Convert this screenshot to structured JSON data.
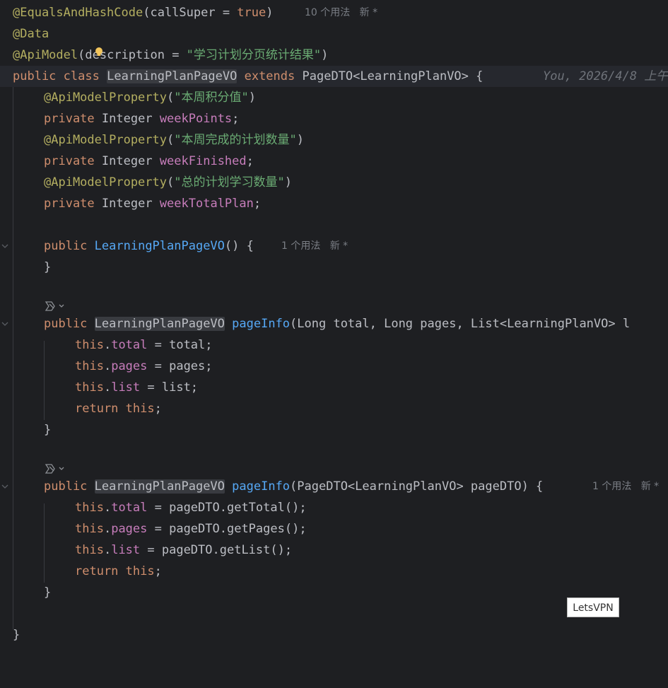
{
  "editor": {
    "language": "java",
    "colors": {
      "background": "#1e1f22",
      "annotation": "#b3ae60",
      "keyword": "#cf8e6d",
      "string": "#6aab73",
      "field": "#c77dbb",
      "method": "#56a8f5",
      "text": "#bcbec4",
      "hint": "#7a7e85"
    },
    "icons": {
      "bulb": "lightbulb-icon",
      "ai": "ai-assistant-icon",
      "fold": "fold-chevron-icon"
    }
  },
  "code": {
    "l1": {
      "ann": "@EqualsAndHashCode",
      "p1": "(callSuper = ",
      "kw": "true",
      "p2": ")",
      "hint1": "10 个用法",
      "hint2": "新 *"
    },
    "l2": {
      "ann": "@Data"
    },
    "l3": {
      "ann": "@ApiModel",
      "p1": "(d",
      "p2": "escription = ",
      "str": "\"学习计划分页统计结果\"",
      "p3": ")"
    },
    "l4": {
      "kw1": "public",
      "kw2": "class",
      "cls": "LearningPlanPageVO",
      "kw3": "extends",
      "rest": "PageDTO<LearningPlanVO> {",
      "blame": "You, 2026/4/8 上午"
    },
    "l5": {
      "ann": "@ApiModelProperty",
      "p1": "(",
      "str": "\"本周积分值\"",
      "p2": ")"
    },
    "l6": {
      "kw": "private",
      "type": "Integer",
      "fld": "weekPoints",
      "p": ";"
    },
    "l7": {
      "ann": "@ApiModelProperty",
      "p1": "(",
      "str": "\"本周完成的计划数量\"",
      "p2": ")"
    },
    "l8": {
      "kw": "private",
      "type": "Integer",
      "fld": "weekFinished",
      "p": ";"
    },
    "l9": {
      "ann": "@ApiModelProperty",
      "p1": "(",
      "str": "\"总的计划学习数量\"",
      "p2": ")"
    },
    "l10": {
      "kw": "private",
      "type": "Integer",
      "fld": "weekTotalPlan",
      "p": ";"
    },
    "l12": {
      "kw": "public",
      "fn": "LearningPlanPageVO",
      "p": "() {",
      "hint1": "1 个用法",
      "hint2": "新 *"
    },
    "l13": {
      "p": "}"
    },
    "l15": {
      "kw": "public",
      "cls": "LearningPlanPageVO",
      "fn": "pageInfo",
      "p": "(Long total, Long pages, List<LearningPlanVO> l"
    },
    "l16": {
      "kw": "this",
      "dot": ".",
      "fld": "total",
      "p": " = total;"
    },
    "l17": {
      "kw": "this",
      "dot": ".",
      "fld": "pages",
      "p": " = pages;"
    },
    "l18": {
      "kw": "this",
      "dot": ".",
      "fld": "list",
      "p": " = list;"
    },
    "l19": {
      "kw1": "return",
      "kw2": "this",
      "p": ";"
    },
    "l20": {
      "p": "}"
    },
    "l22": {
      "kw": "public",
      "cls": "LearningPlanPageVO",
      "fn": "pageInfo",
      "p": "(PageDTO<LearningPlanVO> pageDTO) {",
      "hint1": "1 个用法",
      "hint2": "新 *"
    },
    "l23": {
      "kw": "this",
      "dot": ".",
      "fld": "total",
      "p": " = pageDTO.getTotal();"
    },
    "l24": {
      "kw": "this",
      "dot": ".",
      "fld": "pages",
      "p": " = pageDTO.getPages();"
    },
    "l25": {
      "kw": "this",
      "dot": ".",
      "fld": "list",
      "p": " = pageDTO.getList();"
    },
    "l26": {
      "kw1": "return",
      "kw2": "this",
      "p": ";"
    },
    "l27": {
      "p": "}"
    },
    "l29": {
      "p": "}"
    }
  },
  "tooltip": {
    "text": "LetsVPN"
  }
}
